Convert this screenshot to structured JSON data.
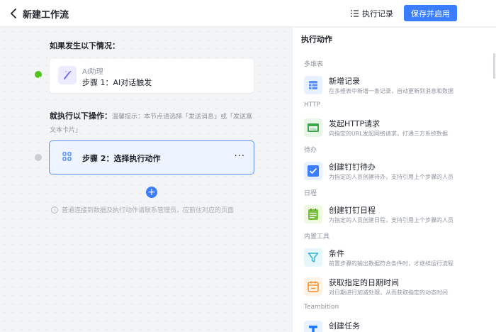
{
  "header": {
    "title": "新建工作流",
    "history_label": "执行记录",
    "save_label": "保存并启用"
  },
  "canvas": {
    "if_label": "如果发生以下情况：",
    "trigger": {
      "app": "AI助理",
      "step": "步骤 1：AI对话触发"
    },
    "then_label": "就执行以下操作：",
    "then_hint": "温馨提示：本节点请选择「发送消息」或「发送富文本卡片」",
    "action": {
      "step": "步骤 2：选择执行动作"
    },
    "notice": "普通连接到数据及执行动作请联系管理员，应前往对应的页面"
  },
  "panel": {
    "title": "执行动作",
    "groups": [
      {
        "label": "多维表",
        "items": [
          {
            "title": "新增记录",
            "desc": "在多维表中新增一条记录，自动更新到消息和数据",
            "icon": "table-icon"
          }
        ]
      },
      {
        "label": "HTTP",
        "items": [
          {
            "title": "发起HTTP请求",
            "desc": "向指定的URL发起网络请求，打通三方系统数据",
            "icon": "http-icon"
          }
        ]
      },
      {
        "label": "待办",
        "items": [
          {
            "title": "创建钉钉待办",
            "desc": "为指定的人员创建待办，支持引用上个步骤的人员",
            "icon": "todo-check-icon"
          }
        ]
      },
      {
        "label": "日程",
        "items": [
          {
            "title": "创建钉钉日程",
            "desc": "为指定的人员创建日程，支持引用上个步骤的人员",
            "icon": "calendar-icon"
          }
        ]
      },
      {
        "label": "内置工具",
        "items": [
          {
            "title": "条件",
            "desc": "前置步骤的输出数据符合条件时，才继续运行流程",
            "icon": "filter-icon"
          },
          {
            "title": "获取指定的日期时间",
            "desc": "对日期进行加减处理，从而获取指定的动态时间",
            "icon": "date-time-icon"
          }
        ]
      },
      {
        "label": "Teambition",
        "items": [
          {
            "title": "创建任务",
            "desc": "",
            "icon": "teambition-icon"
          }
        ]
      }
    ]
  },
  "colors": {
    "accent": "#3a7dff",
    "success": "#52c41a",
    "canvas_bg": "#f3f4f6"
  }
}
